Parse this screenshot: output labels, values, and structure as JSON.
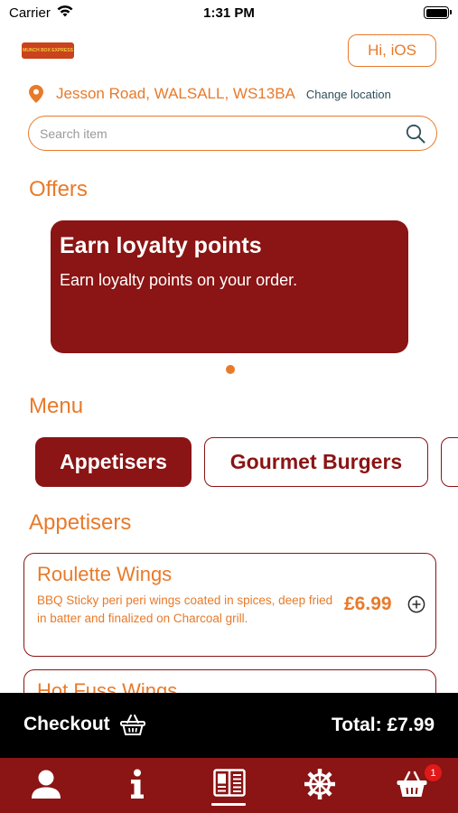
{
  "status_bar": {
    "carrier": "Carrier",
    "time": "1:31 PM"
  },
  "header": {
    "logo_text": "MUNCH BOX EXPRESS",
    "greeting": "Hi, iOS"
  },
  "location": {
    "address": "Jesson Road, WALSALL, WS13BA",
    "change_label": "Change location"
  },
  "search": {
    "placeholder": "Search item"
  },
  "offers": {
    "title": "Offers",
    "cards": [
      {
        "title": "Earn loyalty points",
        "description": "Earn loyalty points on your order."
      }
    ]
  },
  "menu": {
    "title": "Menu",
    "tabs": [
      "Appetisers",
      "Gourmet Burgers"
    ],
    "selected_tab": "Appetisers"
  },
  "category": {
    "title": "Appetisers",
    "items": [
      {
        "name": "Roulette Wings",
        "description": "BBQ Sticky peri peri wings coated in spices, deep fried in batter and finalized on Charcoal grill.",
        "price": "£6.99"
      },
      {
        "name": "Hot Fuss Wings"
      }
    ]
  },
  "checkout": {
    "label": "Checkout",
    "total": "Total: £7.99"
  },
  "tab_bar": {
    "items": [
      "user-icon",
      "info-icon",
      "menu-icon",
      "settings-icon",
      "basket-icon"
    ],
    "basket_badge": "1"
  },
  "colors": {
    "accent_orange": "#e87a2a",
    "brand_maroon": "#8b1414",
    "checkout_black": "#000000",
    "badge_red": "#e01919"
  }
}
